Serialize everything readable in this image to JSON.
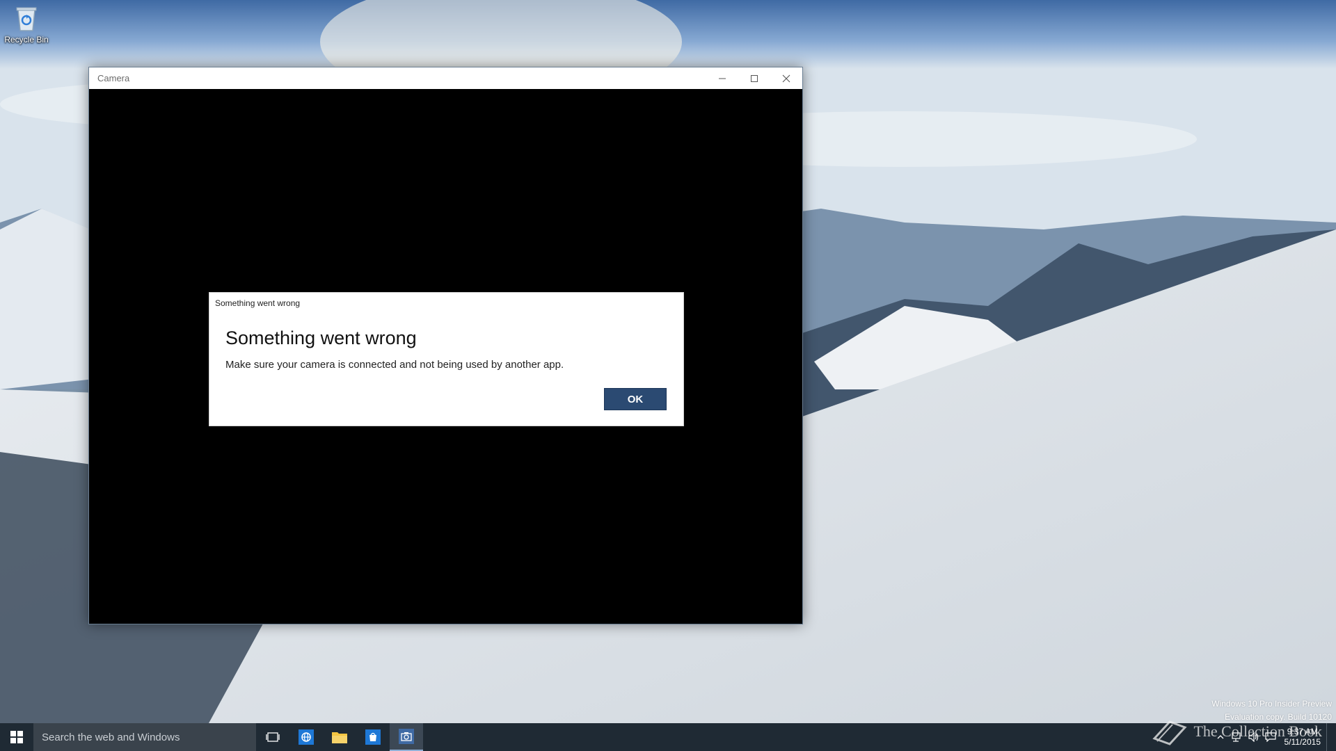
{
  "desktop": {
    "icons": [
      {
        "label": "Recycle Bin",
        "icon": "recycle-bin-icon"
      }
    ]
  },
  "window": {
    "title": "Camera",
    "controls": {
      "minimize": "minimize-icon",
      "maximize": "maximize-icon",
      "close": "close-icon"
    }
  },
  "dialog": {
    "caption": "Something went wrong",
    "heading": "Something went wrong",
    "message": "Make sure your camera is connected and not being used by another app.",
    "ok_label": "OK",
    "ok_color": "#2b4a72"
  },
  "watermark": {
    "line1": "Windows 10 Pro Insider Preview",
    "line2": "Evaluation copy. Build 10120",
    "brand": "The Collection Book"
  },
  "taskbar": {
    "search_placeholder": "Search the web and Windows",
    "pinned": [
      {
        "icon": "task-view-icon",
        "active": false
      },
      {
        "icon": "browser-icon",
        "active": false
      },
      {
        "icon": "file-explorer-icon",
        "active": false
      },
      {
        "icon": "store-icon",
        "active": false
      },
      {
        "icon": "camera-icon",
        "active": true
      }
    ],
    "tray": {
      "icons": [
        "chevron-up-icon",
        "network-icon",
        "volume-icon",
        "notifications-icon"
      ],
      "time": "9:37 AM",
      "date": "5/11/2015"
    }
  }
}
